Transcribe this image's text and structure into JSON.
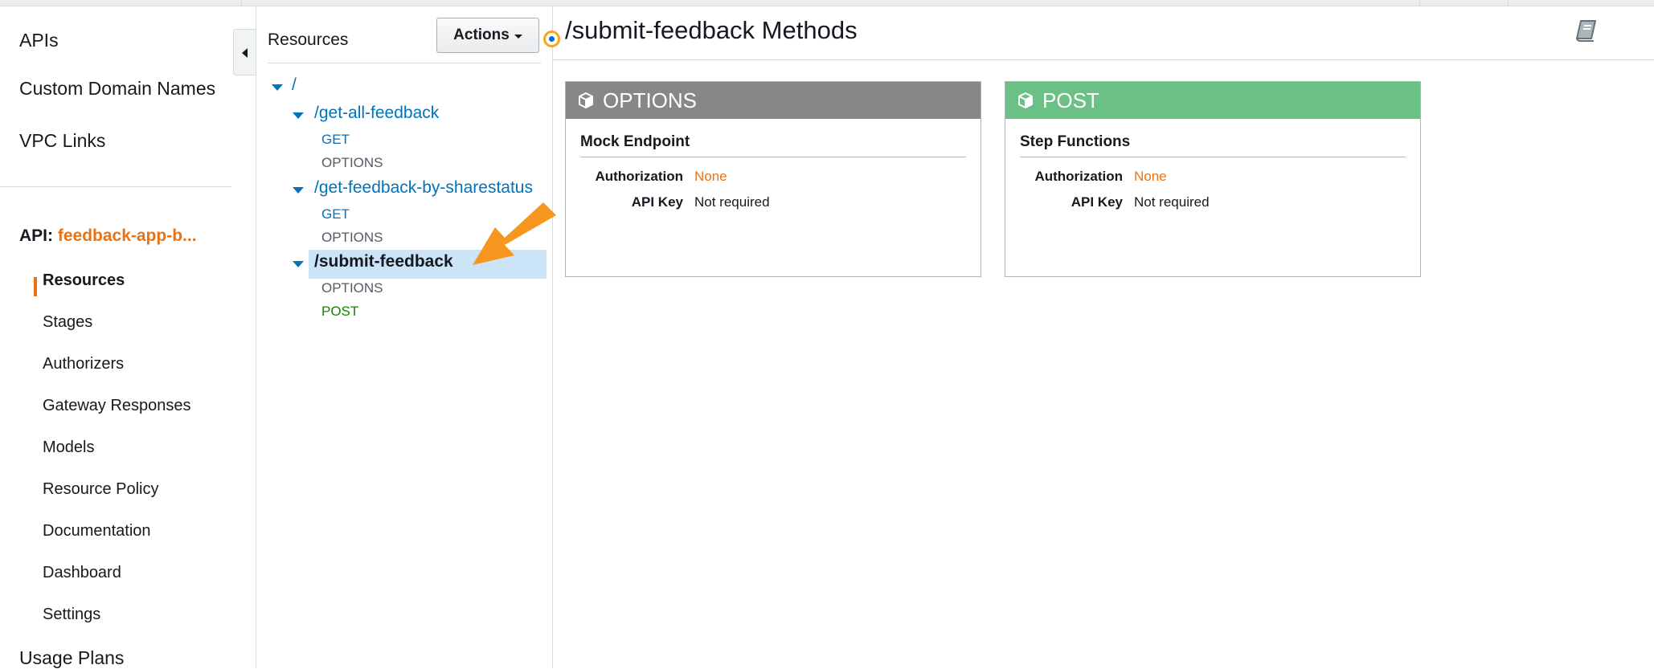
{
  "leftnav": {
    "top_links": [
      "APIs",
      "Custom Domain Names",
      "VPC Links"
    ],
    "api_prefix": "API:",
    "api_name": "feedback-app-b...",
    "sub_items": [
      {
        "label": "Resources",
        "active": true
      },
      {
        "label": "Stages"
      },
      {
        "label": "Authorizers"
      },
      {
        "label": "Gateway Responses"
      },
      {
        "label": "Models"
      },
      {
        "label": "Resource Policy"
      },
      {
        "label": "Documentation"
      },
      {
        "label": "Dashboard"
      },
      {
        "label": "Settings"
      }
    ],
    "bottom_link": "Usage Plans"
  },
  "resources": {
    "header": "Resources",
    "actions_label": "Actions",
    "tree": [
      {
        "path": "/"
      },
      {
        "path": "/get-all-feedback",
        "methods": [
          "GET",
          "OPTIONS"
        ]
      },
      {
        "path": "/get-feedback-by-sharestatus",
        "methods": [
          "GET",
          "OPTIONS"
        ]
      },
      {
        "path": "/submit-feedback",
        "selected": true,
        "methods": [
          "OPTIONS",
          "POST"
        ]
      }
    ]
  },
  "main": {
    "title": "/submit-feedback Methods",
    "cards": [
      {
        "method": "OPTIONS",
        "integration": "Mock Endpoint",
        "auth_label": "Authorization",
        "auth_value": "None",
        "apikey_label": "API Key",
        "apikey_value": "Not required"
      },
      {
        "method": "POST",
        "integration": "Step Functions",
        "auth_label": "Authorization",
        "auth_value": "None",
        "apikey_label": "API Key",
        "apikey_value": "Not required"
      }
    ]
  },
  "icons": {
    "collapse": "chevron-left-icon",
    "caret": "caret-down-icon",
    "tree_toggle": "triangle-down-icon",
    "method": "cube-icon",
    "docs": "book-icon",
    "annotation": "arrow-icon"
  },
  "colors": {
    "link_blue": "#0073bb",
    "accent_orange": "#ec7211",
    "options_header": "#878787",
    "post_header": "#6bc085",
    "selected_row": "#cce4f7",
    "annotation_arrow": "#f6961e"
  }
}
